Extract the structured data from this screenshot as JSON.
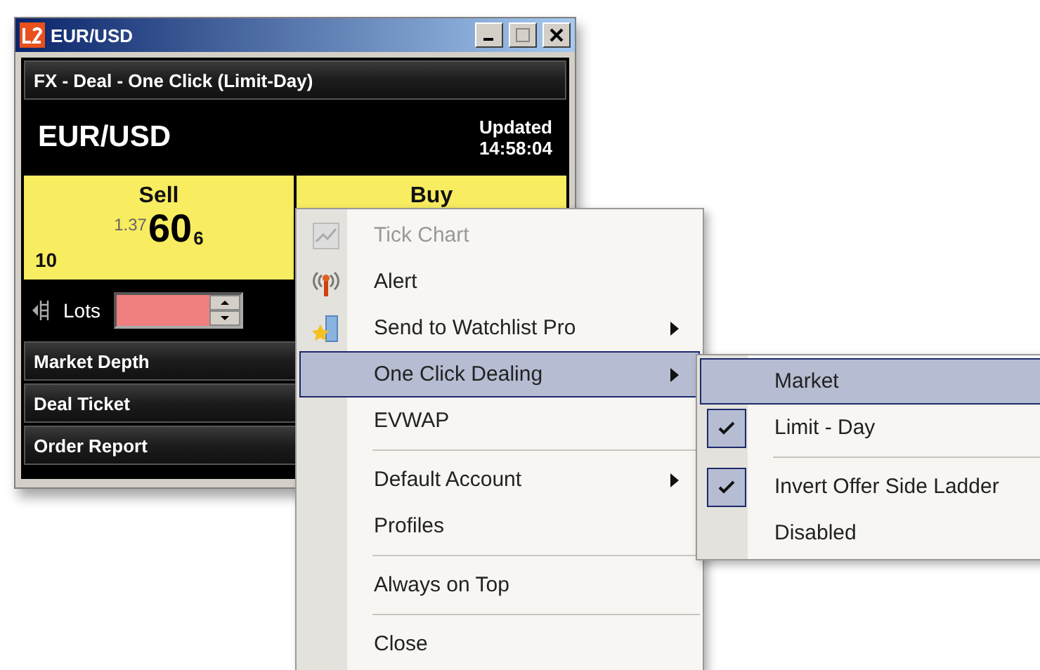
{
  "window": {
    "title": "EUR/USD"
  },
  "deal_bar": {
    "title": "FX - Deal - One Click (Limit-Day)"
  },
  "header": {
    "symbol": "EUR/USD",
    "updated_label": "Updated",
    "time": "14:58:04"
  },
  "sell": {
    "label": "Sell",
    "size": "10",
    "price_prefix": "1.37",
    "price_big": "60",
    "price_pip": "6"
  },
  "buy": {
    "label": "Buy"
  },
  "lots": {
    "label": "Lots"
  },
  "sections": [
    "Market Depth",
    "Deal Ticket",
    "Order Report"
  ],
  "context_menu": [
    {
      "kind": "item",
      "label": "Tick Chart",
      "disabled": true,
      "selected": false,
      "submenu": false
    },
    {
      "kind": "item",
      "label": "Alert",
      "disabled": false,
      "selected": false,
      "submenu": false
    },
    {
      "kind": "item",
      "label": "Send to Watchlist Pro",
      "disabled": false,
      "selected": false,
      "submenu": true
    },
    {
      "kind": "item",
      "label": "One Click Dealing",
      "disabled": false,
      "selected": true,
      "submenu": true
    },
    {
      "kind": "item",
      "label": "EVWAP",
      "disabled": false,
      "selected": false,
      "submenu": false
    },
    {
      "kind": "separator"
    },
    {
      "kind": "item",
      "label": "Default Account",
      "disabled": false,
      "selected": false,
      "submenu": true
    },
    {
      "kind": "item",
      "label": "Profiles",
      "disabled": false,
      "selected": false,
      "submenu": false
    },
    {
      "kind": "separator"
    },
    {
      "kind": "item",
      "label": "Always on Top",
      "disabled": false,
      "selected": false,
      "submenu": false
    },
    {
      "kind": "separator"
    },
    {
      "kind": "item",
      "label": "Close",
      "disabled": false,
      "selected": false,
      "submenu": false
    }
  ],
  "submenu": [
    {
      "kind": "item",
      "label": "Market",
      "checked": false,
      "selected": true
    },
    {
      "kind": "item",
      "label": "Limit - Day",
      "checked": true,
      "selected": false
    },
    {
      "kind": "separator"
    },
    {
      "kind": "item",
      "label": "Invert Offer Side Ladder",
      "checked": true,
      "selected": false
    },
    {
      "kind": "item",
      "label": "Disabled",
      "checked": false,
      "selected": false
    }
  ]
}
